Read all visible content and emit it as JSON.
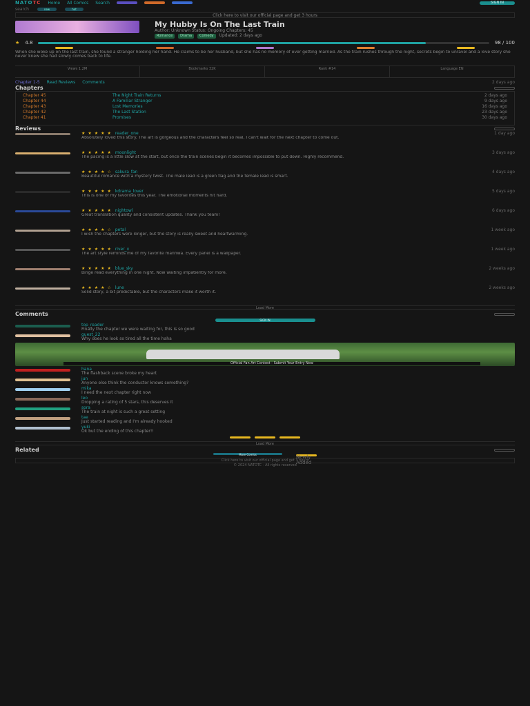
{
  "nav": {
    "logo_a": "NATO",
    "logo_b": "TC",
    "links": [
      "Home",
      "All Comics",
      "Search"
    ],
    "signin_label": "SIGN IN",
    "pill_colors": [
      "#5a4fc0",
      "#d06a2a",
      "#3a6ad0"
    ]
  },
  "subnav": {
    "search_label": "search",
    "badges": [
      "new",
      "hot"
    ]
  },
  "banner": "Click here to visit our official page and get 3 hours",
  "comic": {
    "title": "My Hubby Is On The Last Train",
    "meta1": "Author: Unknown   Status: Ongoing   Chapters: 45",
    "meta2": "Updated: 2 days ago",
    "genres": [
      "Romance",
      "Drama",
      "Comedy"
    ],
    "rating_label": "4.8",
    "score_label": "98 / 100",
    "progress": 0.86,
    "description": "When she woke up on the last train, she found a stranger holding her hand. He claims to be her husband, but she has no memory of ever getting married. As the train rushes through the night, secrets begin to unravel and a love story she never knew she had slowly comes back to life.",
    "info_cells": [
      "Views 1.2M",
      "Bookmarks 32K",
      "Rank #14",
      "Language EN"
    ],
    "tags": [
      "Chapter 1-5",
      "Read Reviews",
      "Comments"
    ],
    "updated": "2 days ago"
  },
  "chapters": {
    "heading": "Chapters",
    "items": [
      {
        "num": "Chapter 45",
        "name": "The Night Train Returns",
        "date": "2 days ago"
      },
      {
        "num": "Chapter 44",
        "name": "A Familiar Stranger",
        "date": "9 days ago"
      },
      {
        "num": "Chapter 43",
        "name": "Lost Memories",
        "date": "16 days ago"
      },
      {
        "num": "Chapter 42",
        "name": "The Last Station",
        "date": "23 days ago"
      },
      {
        "num": "Chapter 41",
        "name": "Promises",
        "date": "30 days ago"
      }
    ]
  },
  "reviews": {
    "heading": "Reviews",
    "items": [
      {
        "name": "reader_one",
        "stars": "★★★★★",
        "date": "1 day ago",
        "text": "Absolutely loved this story. The art is gorgeous and the characters feel so real, I can't wait for the next chapter to come out."
      },
      {
        "name": "moonlight",
        "stars": "★★★★★",
        "date": "3 days ago",
        "text": "The pacing is a little slow at the start, but once the train scenes begin it becomes impossible to put down. Highly recommend."
      },
      {
        "name": "sakura_fan",
        "stars": "★★★★☆",
        "date": "4 days ago",
        "text": "Beautiful romance with a mystery twist. The male lead is a green flag and the female lead is smart."
      },
      {
        "name": "kdrama_lover",
        "stars": "★★★★★",
        "date": "5 days ago",
        "text": "This is one of my favorites this year. The emotional moments hit hard."
      },
      {
        "name": "nightowl",
        "stars": "★★★★★",
        "date": "6 days ago",
        "text": "Great translation quality and consistent updates. Thank you team!"
      },
      {
        "name": "petal",
        "stars": "★★★★☆",
        "date": "1 week ago",
        "text": "I wish the chapters were longer, but the story is really sweet and heartwarming."
      },
      {
        "name": "river_x",
        "stars": "★★★★★",
        "date": "1 week ago",
        "text": "The art style reminds me of my favorite manhwa. Every panel is a wallpaper."
      },
      {
        "name": "blue_sky",
        "stars": "★★★★★",
        "date": "2 weeks ago",
        "text": "Binge read everything in one night. Now waiting impatiently for more."
      },
      {
        "name": "lune",
        "stars": "★★★★☆",
        "date": "2 weeks ago",
        "text": "Solid story, a bit predictable, but the characters make it worth it."
      }
    ],
    "load_more": "Load More"
  },
  "comments": {
    "heading": "Comments",
    "signin_label": "SIGN IN",
    "items": [
      {
        "name": "top_reader",
        "text": "Finally the chapter we were waiting for, this is so good"
      },
      {
        "name": "guest_22",
        "text": "Why does he look so tired all the time haha"
      },
      {
        "name": "hana",
        "text": "The flashback scene broke my heart"
      },
      {
        "name": "jun",
        "text": "Anyone else think the conductor knows something?"
      },
      {
        "name": "mika",
        "text": "I need the next chapter right now"
      },
      {
        "name": "leo",
        "text": "Dropping a rating of 5 stars, this deserves it"
      },
      {
        "name": "sora",
        "text": "The train at night is such a great setting"
      },
      {
        "name": "tae",
        "text": "Just started reading and I'm already hooked"
      },
      {
        "name": "yuki",
        "text": "Ok but the ending of this chapter!!"
      }
    ],
    "photo_caption": "Official Fan Art Contest - Submit Your Entry Now",
    "load_more": "Load More"
  },
  "related": {
    "heading": "Related",
    "buttons": [
      "More Comics",
      "Newly Added"
    ]
  },
  "footer": {
    "bar": "Click here to visit our official page and get 3 hours",
    "copyright": "© 2024 NATOTC - All rights reserved"
  }
}
